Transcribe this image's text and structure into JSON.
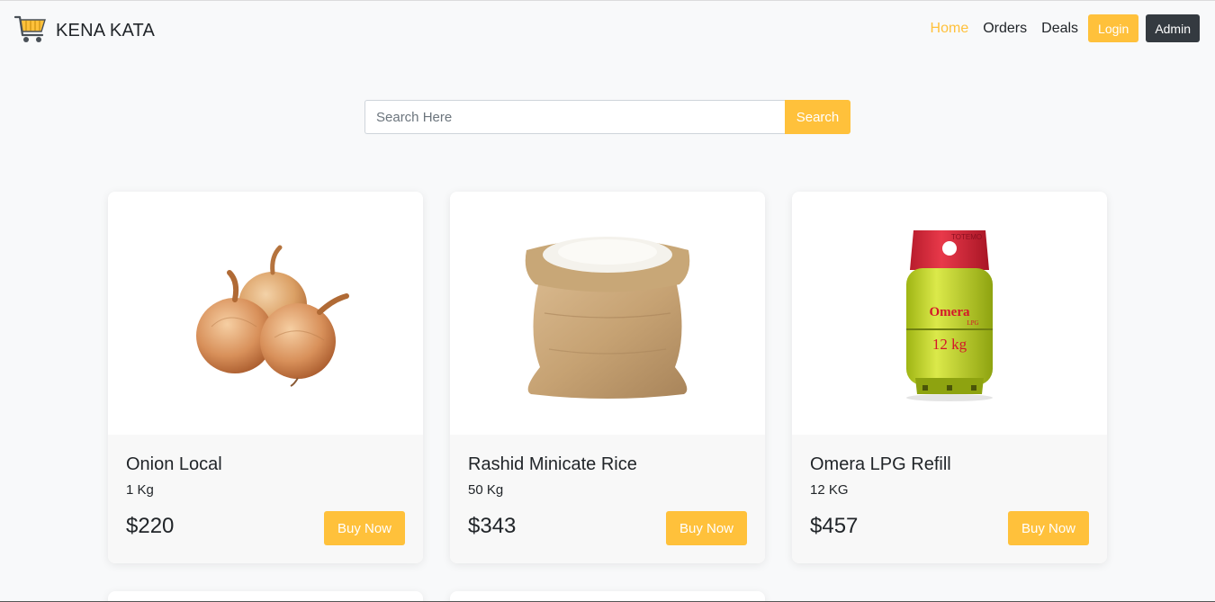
{
  "brand": {
    "name": "KENA KATA",
    "accent": "#ffc13b"
  },
  "nav": {
    "home": "Home",
    "orders": "Orders",
    "deals": "Deals",
    "login": "Login",
    "admin": "Admin"
  },
  "search": {
    "placeholder": "Search Here",
    "button": "Search"
  },
  "products": [
    {
      "name": "Onion Local",
      "qty": "1 Kg",
      "price": "$220",
      "button": "Buy Now",
      "image": "onion-image"
    },
    {
      "name": "Rashid Minicate Rice",
      "qty": "50 Kg",
      "price": "$343",
      "button": "Buy Now",
      "image": "rice-sack-image"
    },
    {
      "name": "Omera LPG Refill",
      "qty": "12 KG",
      "price": "$457",
      "button": "Buy Now",
      "image": "lpg-cylinder-image",
      "image_text": [
        "Omera",
        "LPG",
        "12 kg",
        "TOTEMO"
      ]
    }
  ],
  "colors": {
    "accent": "#ffc13b",
    "dark": "#343a40",
    "background": "#f8f9fa"
  }
}
